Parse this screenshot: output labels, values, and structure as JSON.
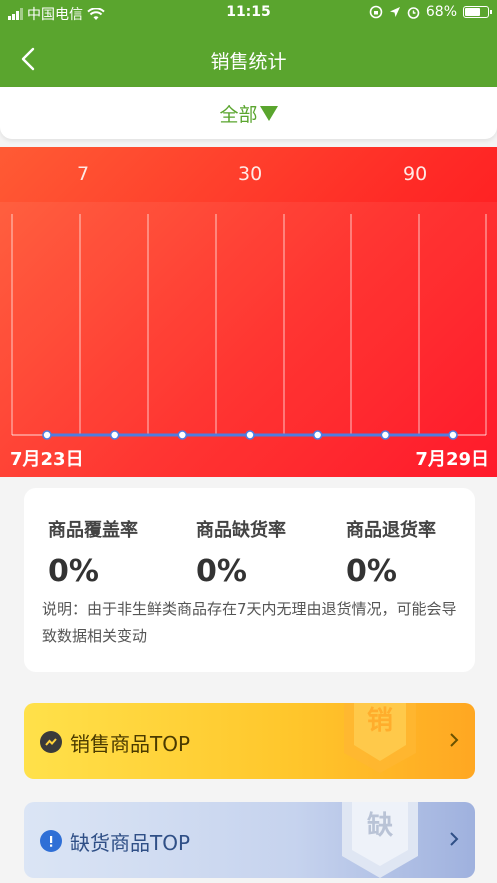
{
  "status_bar": {
    "carrier": "中国电信",
    "time": "11:15",
    "battery": "68%"
  },
  "nav": {
    "title": "销售统计"
  },
  "filter": {
    "label": "全部"
  },
  "ranges": [
    "7",
    "30",
    "90"
  ],
  "chart_data": {
    "type": "line",
    "x": [
      "7月23日",
      "",
      "",
      "",
      "",
      "",
      "7月29日"
    ],
    "values": [
      0,
      0,
      0,
      0,
      0,
      0,
      0
    ],
    "start_label": "7月23日",
    "end_label": "7月29日",
    "colors": {
      "line": "#4f7de0",
      "point_fill": "#ffffff"
    }
  },
  "stats": [
    {
      "label": "商品覆盖率",
      "value": "0%"
    },
    {
      "label": "商品缺货率",
      "value": "0%"
    },
    {
      "label": "商品退货率",
      "value": "0%"
    }
  ],
  "note": "说明：由于非生鲜类商品存在7天内无理由退货情况，可能会导致数据相关变动",
  "cards": {
    "sales": {
      "label": "销售商品TOP",
      "badge_char": "销",
      "icon": "trend-icon"
    },
    "out_of_stock": {
      "label": "缺货商品TOP",
      "badge_char": "缺",
      "icon": "exclamation-icon"
    }
  },
  "colors": {
    "brand_green": "#5aa52e",
    "chart_red": "#ff2a26"
  }
}
